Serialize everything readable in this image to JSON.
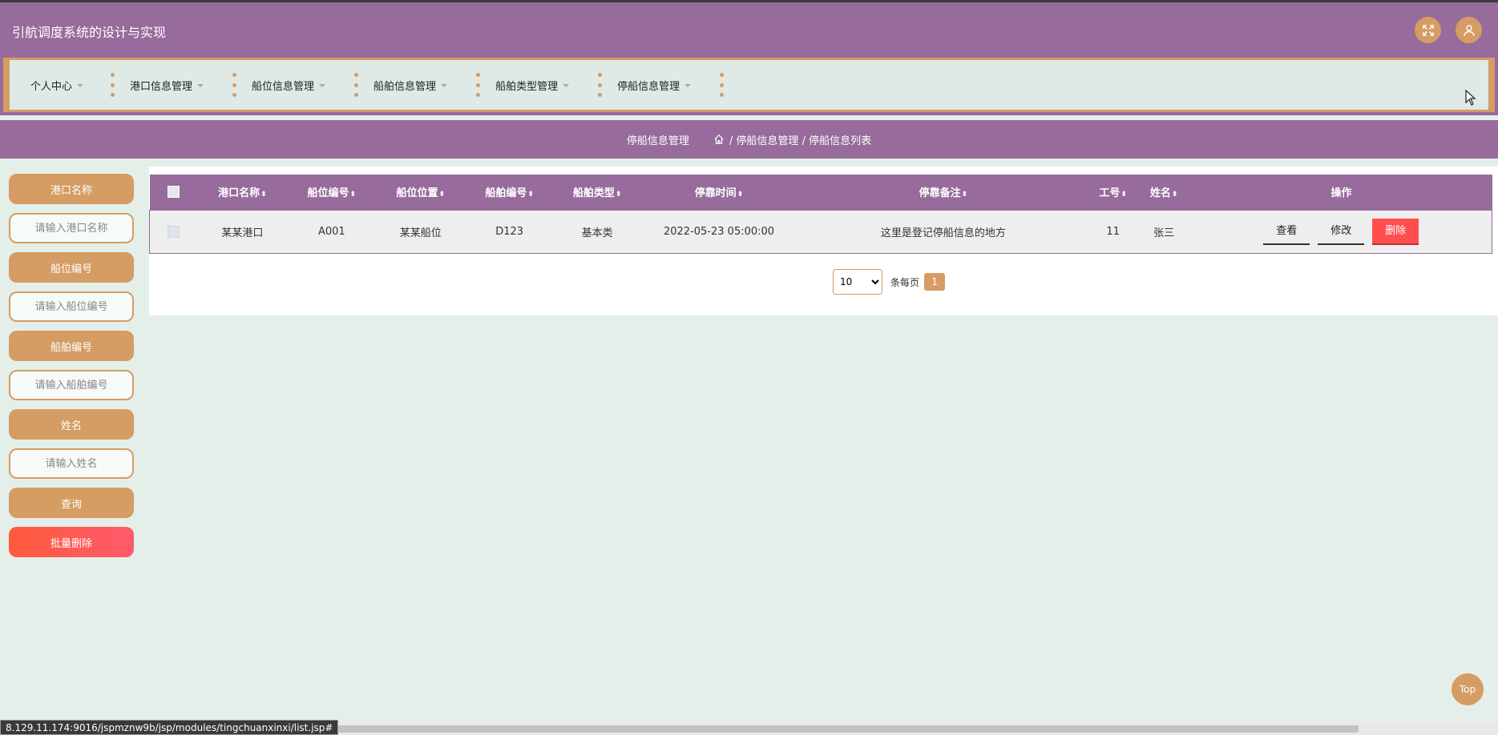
{
  "app": {
    "title": "引航调度系统的设计与实现"
  },
  "header": {
    "fullscreen_icon": "fullscreen-icon",
    "user_icon": "user-avatar-icon"
  },
  "nav": {
    "items": [
      {
        "label": "个人中心"
      },
      {
        "label": "港口信息管理"
      },
      {
        "label": "船位信息管理"
      },
      {
        "label": "船舶信息管理"
      },
      {
        "label": "船舶类型管理"
      },
      {
        "label": "停船信息管理"
      }
    ]
  },
  "breadcrumb": {
    "title": "停船信息管理",
    "path": "/ 停船信息管理 / 停船信息列表"
  },
  "filters": {
    "port_label": "港口名称",
    "port_placeholder": "请输入港口名称",
    "berth_label": "船位编号",
    "berth_placeholder": "请输入船位编号",
    "ship_label": "船舶编号",
    "ship_placeholder": "请输入船舶编号",
    "name_label": "姓名",
    "name_placeholder": "请输入姓名",
    "search_button": "查询",
    "batch_delete_button": "批量删除"
  },
  "table": {
    "columns": [
      "港口名称",
      "船位编号",
      "船位位置",
      "船舶编号",
      "船舶类型",
      "停靠时间",
      "停靠备注",
      "工号",
      "姓名"
    ],
    "action_column": "操作",
    "rows": [
      {
        "port": "某某港口",
        "berth_no": "A001",
        "berth_pos": "某某船位",
        "ship_no": "D123",
        "ship_type": "基本类",
        "time": "2022-05-23 05:00:00",
        "remark": "这里是登记停船信息的地方",
        "emp_no": "11",
        "name": "张三",
        "view": "查看",
        "edit": "修改",
        "delete": "删除"
      }
    ]
  },
  "pagination": {
    "page_size": "10",
    "per_page_label": "条每页",
    "current_page": "1"
  },
  "back_to_top": "Top",
  "status_url": "8.129.11.174:9016/jspmznw9b/jsp/modules/tingchuanxinxi/list.jsp#"
}
